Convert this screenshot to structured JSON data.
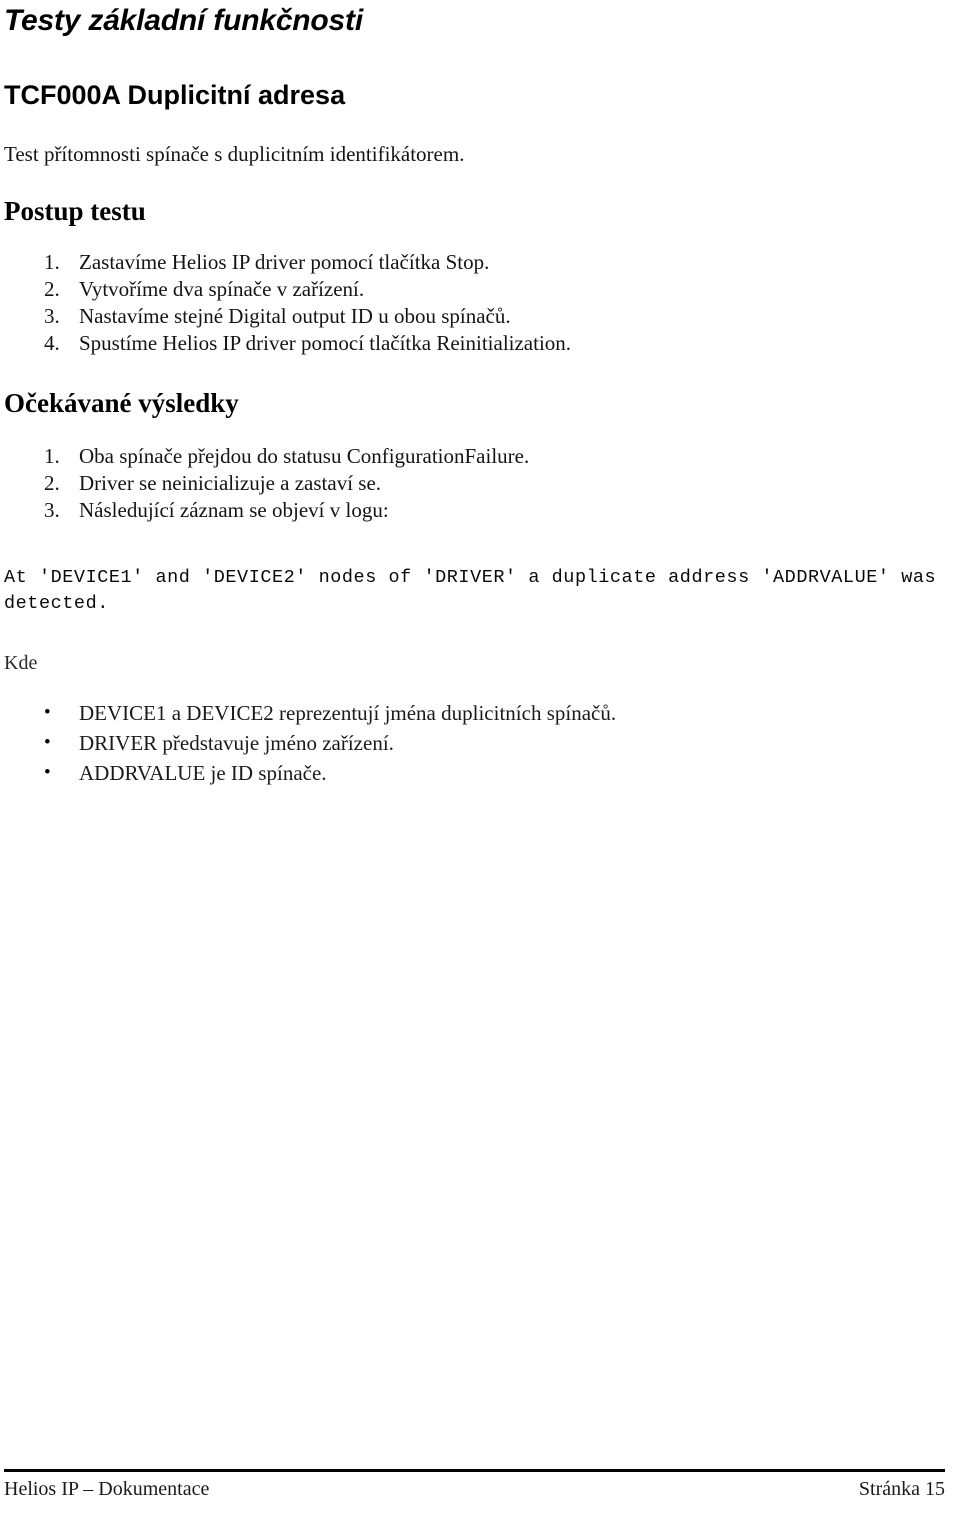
{
  "document": {
    "title": "Testy základní funkčnosti",
    "subtitle": "TCF000A Duplicitní adresa",
    "lead": "Test přítomnosti spínače s duplicitním identifikátorem."
  },
  "procedure": {
    "heading": "Postup testu",
    "steps": [
      "Zastavíme Helios IP driver pomocí tlačítka Stop.",
      "Vytvoříme dva spínače v zařízení.",
      "Nastavíme stejné Digital output ID u obou spínačů.",
      "Spustíme Helios IP driver pomocí tlačítka Reinitialization."
    ]
  },
  "expected_results": {
    "heading": "Očekávané výsledky",
    "items": [
      "Oba spínače přejdou do statusu ConfigurationFailure.",
      "Driver se neinicializuje a zastaví se.",
      "Následující záznam se objeví v logu:"
    ]
  },
  "log_entry": "At 'DEVICE1' and 'DEVICE2' nodes of 'DRIVER' a duplicate address 'ADDRVALUE' was detected.",
  "where": {
    "label": "Kde",
    "definitions": [
      "DEVICE1 a DEVICE2 reprezentují jména duplicitních spínačů.",
      "DRIVER představuje jméno zařízení.",
      "ADDRVALUE je ID spínače."
    ]
  },
  "footer": {
    "left": "Helios IP – Dokumentace",
    "right": "Stránka 15"
  }
}
